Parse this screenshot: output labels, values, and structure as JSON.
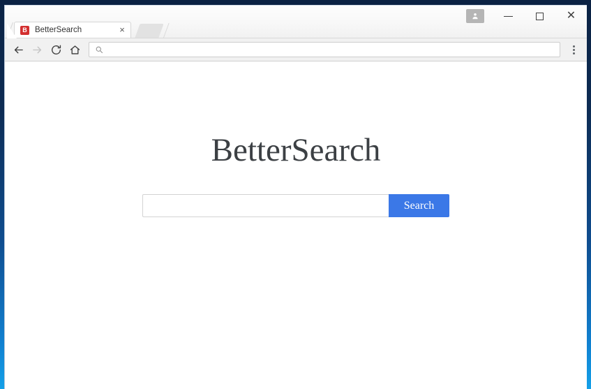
{
  "desktop": {
    "wallpaper_top_color": "#0b2243",
    "wallpaper_bottom_color": "#14a0e8"
  },
  "browser": {
    "tabs": [
      {
        "title": "BetterSearch",
        "favicon_letter": "B",
        "favicon_color": "#d32f2f",
        "close_label": "×",
        "active": true
      }
    ],
    "window_controls": {
      "profile_label": "",
      "minimize_label": "",
      "maximize_label": "",
      "close_label": "✕"
    },
    "toolbar": {
      "back_label": "",
      "forward_label": "",
      "reload_label": "",
      "home_label": "",
      "menu_label": "",
      "omnibox": {
        "value": "",
        "placeholder": ""
      }
    }
  },
  "page": {
    "brand_title": "BetterSearch",
    "search": {
      "input_value": "",
      "input_placeholder": "",
      "button_label": "Search",
      "button_color": "#3b78e7"
    }
  }
}
